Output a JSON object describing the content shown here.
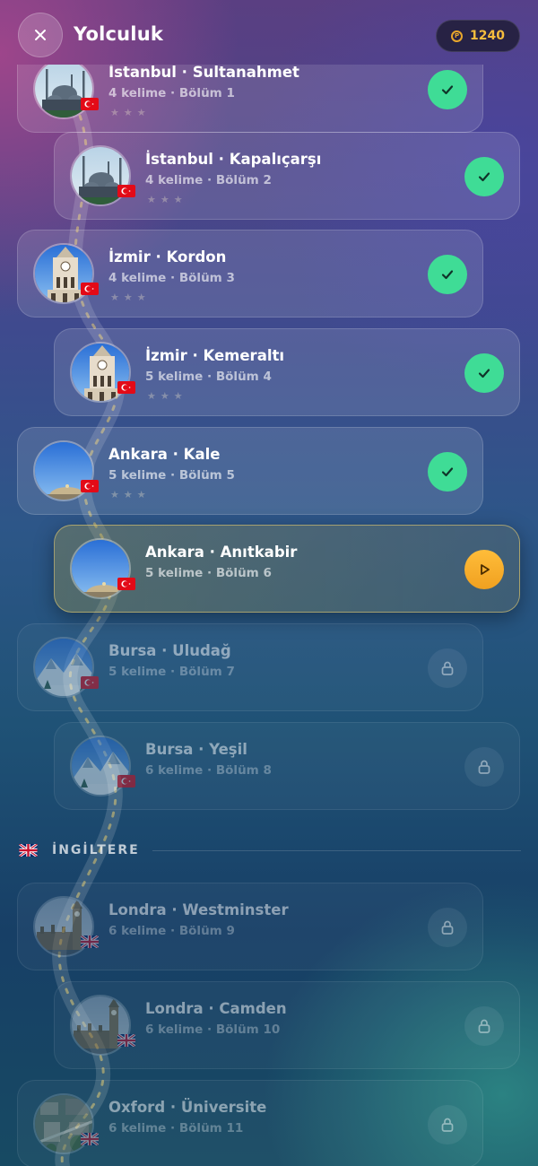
{
  "header": {
    "title": "Yolculuk",
    "coins": "1240",
    "close_icon": "close-icon",
    "coin_icon": "coin-icon"
  },
  "colors": {
    "completed": "#3fdc96",
    "current": "#f6b02c",
    "coin": "#f6bd3d"
  },
  "levels": [
    {
      "title": "İstanbul · Sultanahmet",
      "subtitle": "4 kelime · Bölüm 1",
      "status": "completed",
      "thumb": "mosque",
      "flag": "tr",
      "stars": "★★★"
    },
    {
      "title": "İstanbul · Kapalıçarşı",
      "subtitle": "4 kelime · Bölüm 2",
      "status": "completed",
      "thumb": "mosque",
      "flag": "tr",
      "stars": "★★★"
    },
    {
      "title": "İzmir · Kordon",
      "subtitle": "4 kelime · Bölüm 3",
      "status": "completed",
      "thumb": "clocktower",
      "flag": "tr",
      "stars": "★★★"
    },
    {
      "title": "İzmir · Kemeraltı",
      "subtitle": "5 kelime · Bölüm 4",
      "status": "completed",
      "thumb": "clocktower",
      "flag": "tr",
      "stars": "★★★"
    },
    {
      "title": "Ankara · Kale",
      "subtitle": "5 kelime · Bölüm 5",
      "status": "completed",
      "thumb": "dome",
      "flag": "tr",
      "stars": "★★★"
    },
    {
      "title": "Ankara · Anıtkabir",
      "subtitle": "5 kelime · Bölüm 6",
      "status": "current",
      "thumb": "dome",
      "flag": "tr",
      "stars": ""
    },
    {
      "title": "Bursa · Uludağ",
      "subtitle": "5 kelime · Bölüm 7",
      "status": "locked",
      "thumb": "mountain",
      "flag": "tr",
      "stars": ""
    },
    {
      "title": "Bursa · Yeşil",
      "subtitle": "6 kelime · Bölüm 8",
      "status": "locked",
      "thumb": "mountain",
      "flag": "tr",
      "stars": ""
    },
    {
      "title": "Londra · Westminster",
      "subtitle": "6 kelime · Bölüm 9",
      "status": "locked",
      "thumb": "bigben",
      "flag": "uk",
      "stars": ""
    },
    {
      "title": "Londra · Camden",
      "subtitle": "6 kelime · Bölüm 10",
      "status": "locked",
      "thumb": "bigben",
      "flag": "uk",
      "stars": ""
    },
    {
      "title": "Oxford · Üniversite",
      "subtitle": "6 kelime · Bölüm 11",
      "status": "locked",
      "thumb": "aerial",
      "flag": "uk",
      "stars": ""
    }
  ],
  "section": {
    "label": "İNGİLTERE",
    "flag": "uk"
  }
}
